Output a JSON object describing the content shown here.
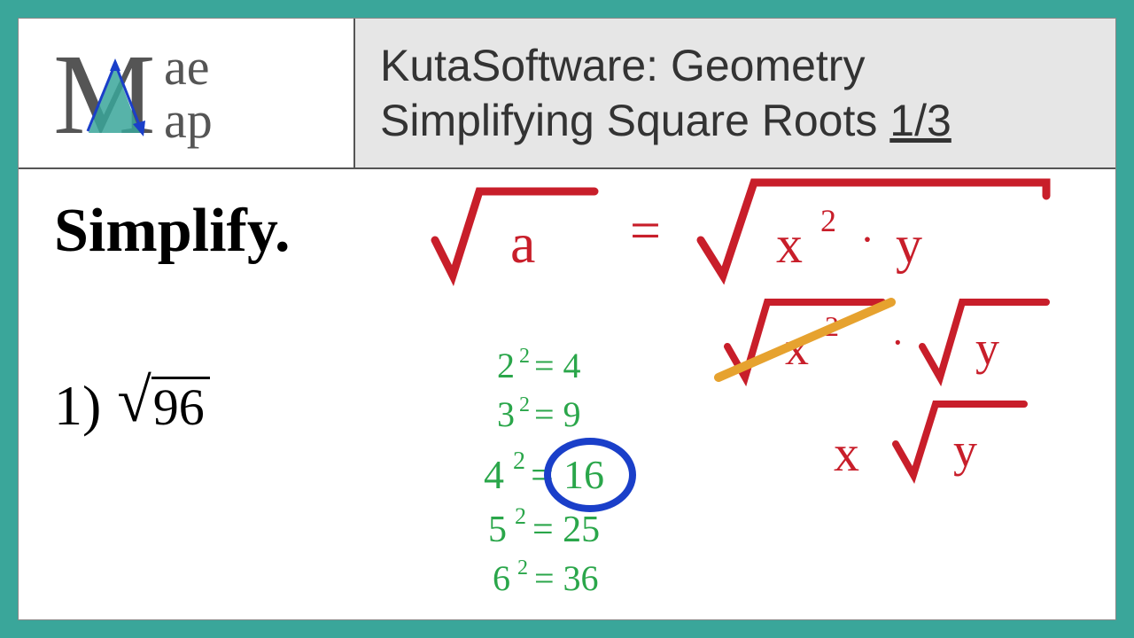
{
  "logo": {
    "top": "ae",
    "bottom": "ap",
    "prefix": "M"
  },
  "title": {
    "line1": "KutaSoftware: Geometry",
    "line2_pre": "Simplifying Square Roots ",
    "line2_frac": "1/3"
  },
  "instruction": "Simplify.",
  "problem": {
    "number": "1)",
    "value": "96"
  },
  "work": {
    "sqrt_a": "a",
    "sqrt_decomp": "x² · y",
    "step2": "√x² · √y",
    "result": "x √y",
    "squares": [
      {
        "base": "2",
        "val": "4"
      },
      {
        "base": "3",
        "val": "9"
      },
      {
        "base": "4",
        "val": "16",
        "circled": true
      },
      {
        "base": "5",
        "val": "25"
      },
      {
        "base": "6",
        "val": "36"
      }
    ]
  },
  "colors": {
    "border": "#3aa69a",
    "red": "#c81e2a",
    "green": "#2aa64a",
    "blue": "#1a3fc9",
    "orange": "#e6a22f"
  }
}
